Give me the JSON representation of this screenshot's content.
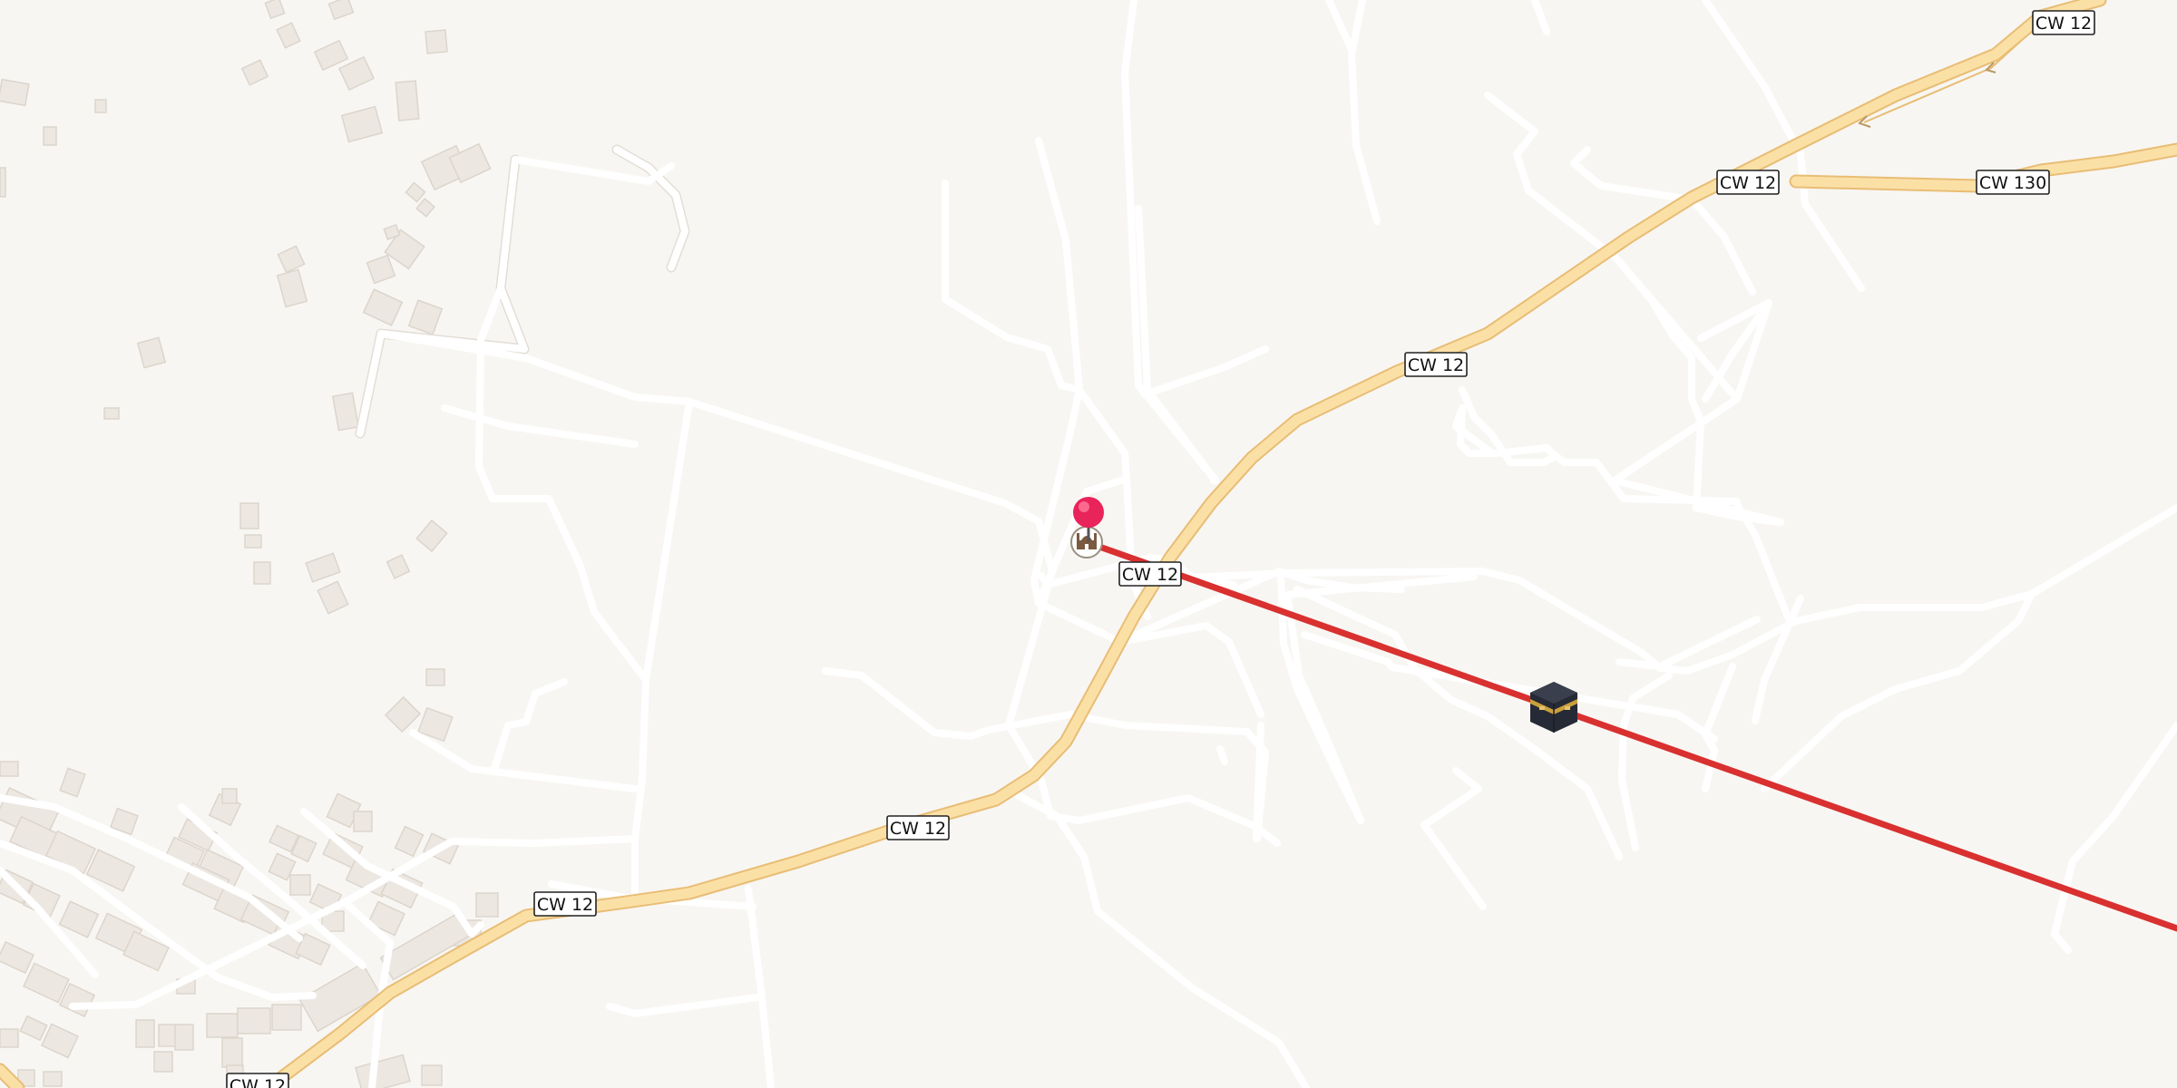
{
  "map": {
    "background_color": "#f8f6f2",
    "highway_color": "#fbe0a6",
    "highway_casing_color": "#e8bd75",
    "route_line_color": "#d93030",
    "pin_color": "#e8245a",
    "road_labels": [
      "CW 12",
      "CW 12",
      "CW 130",
      "CW 12",
      "CW 12",
      "CW 12",
      "CW 12",
      "CW 12"
    ],
    "markers": {
      "pin": "location-pin",
      "mosque": "mosque-icon",
      "kaaba": "kaaba-icon"
    }
  }
}
